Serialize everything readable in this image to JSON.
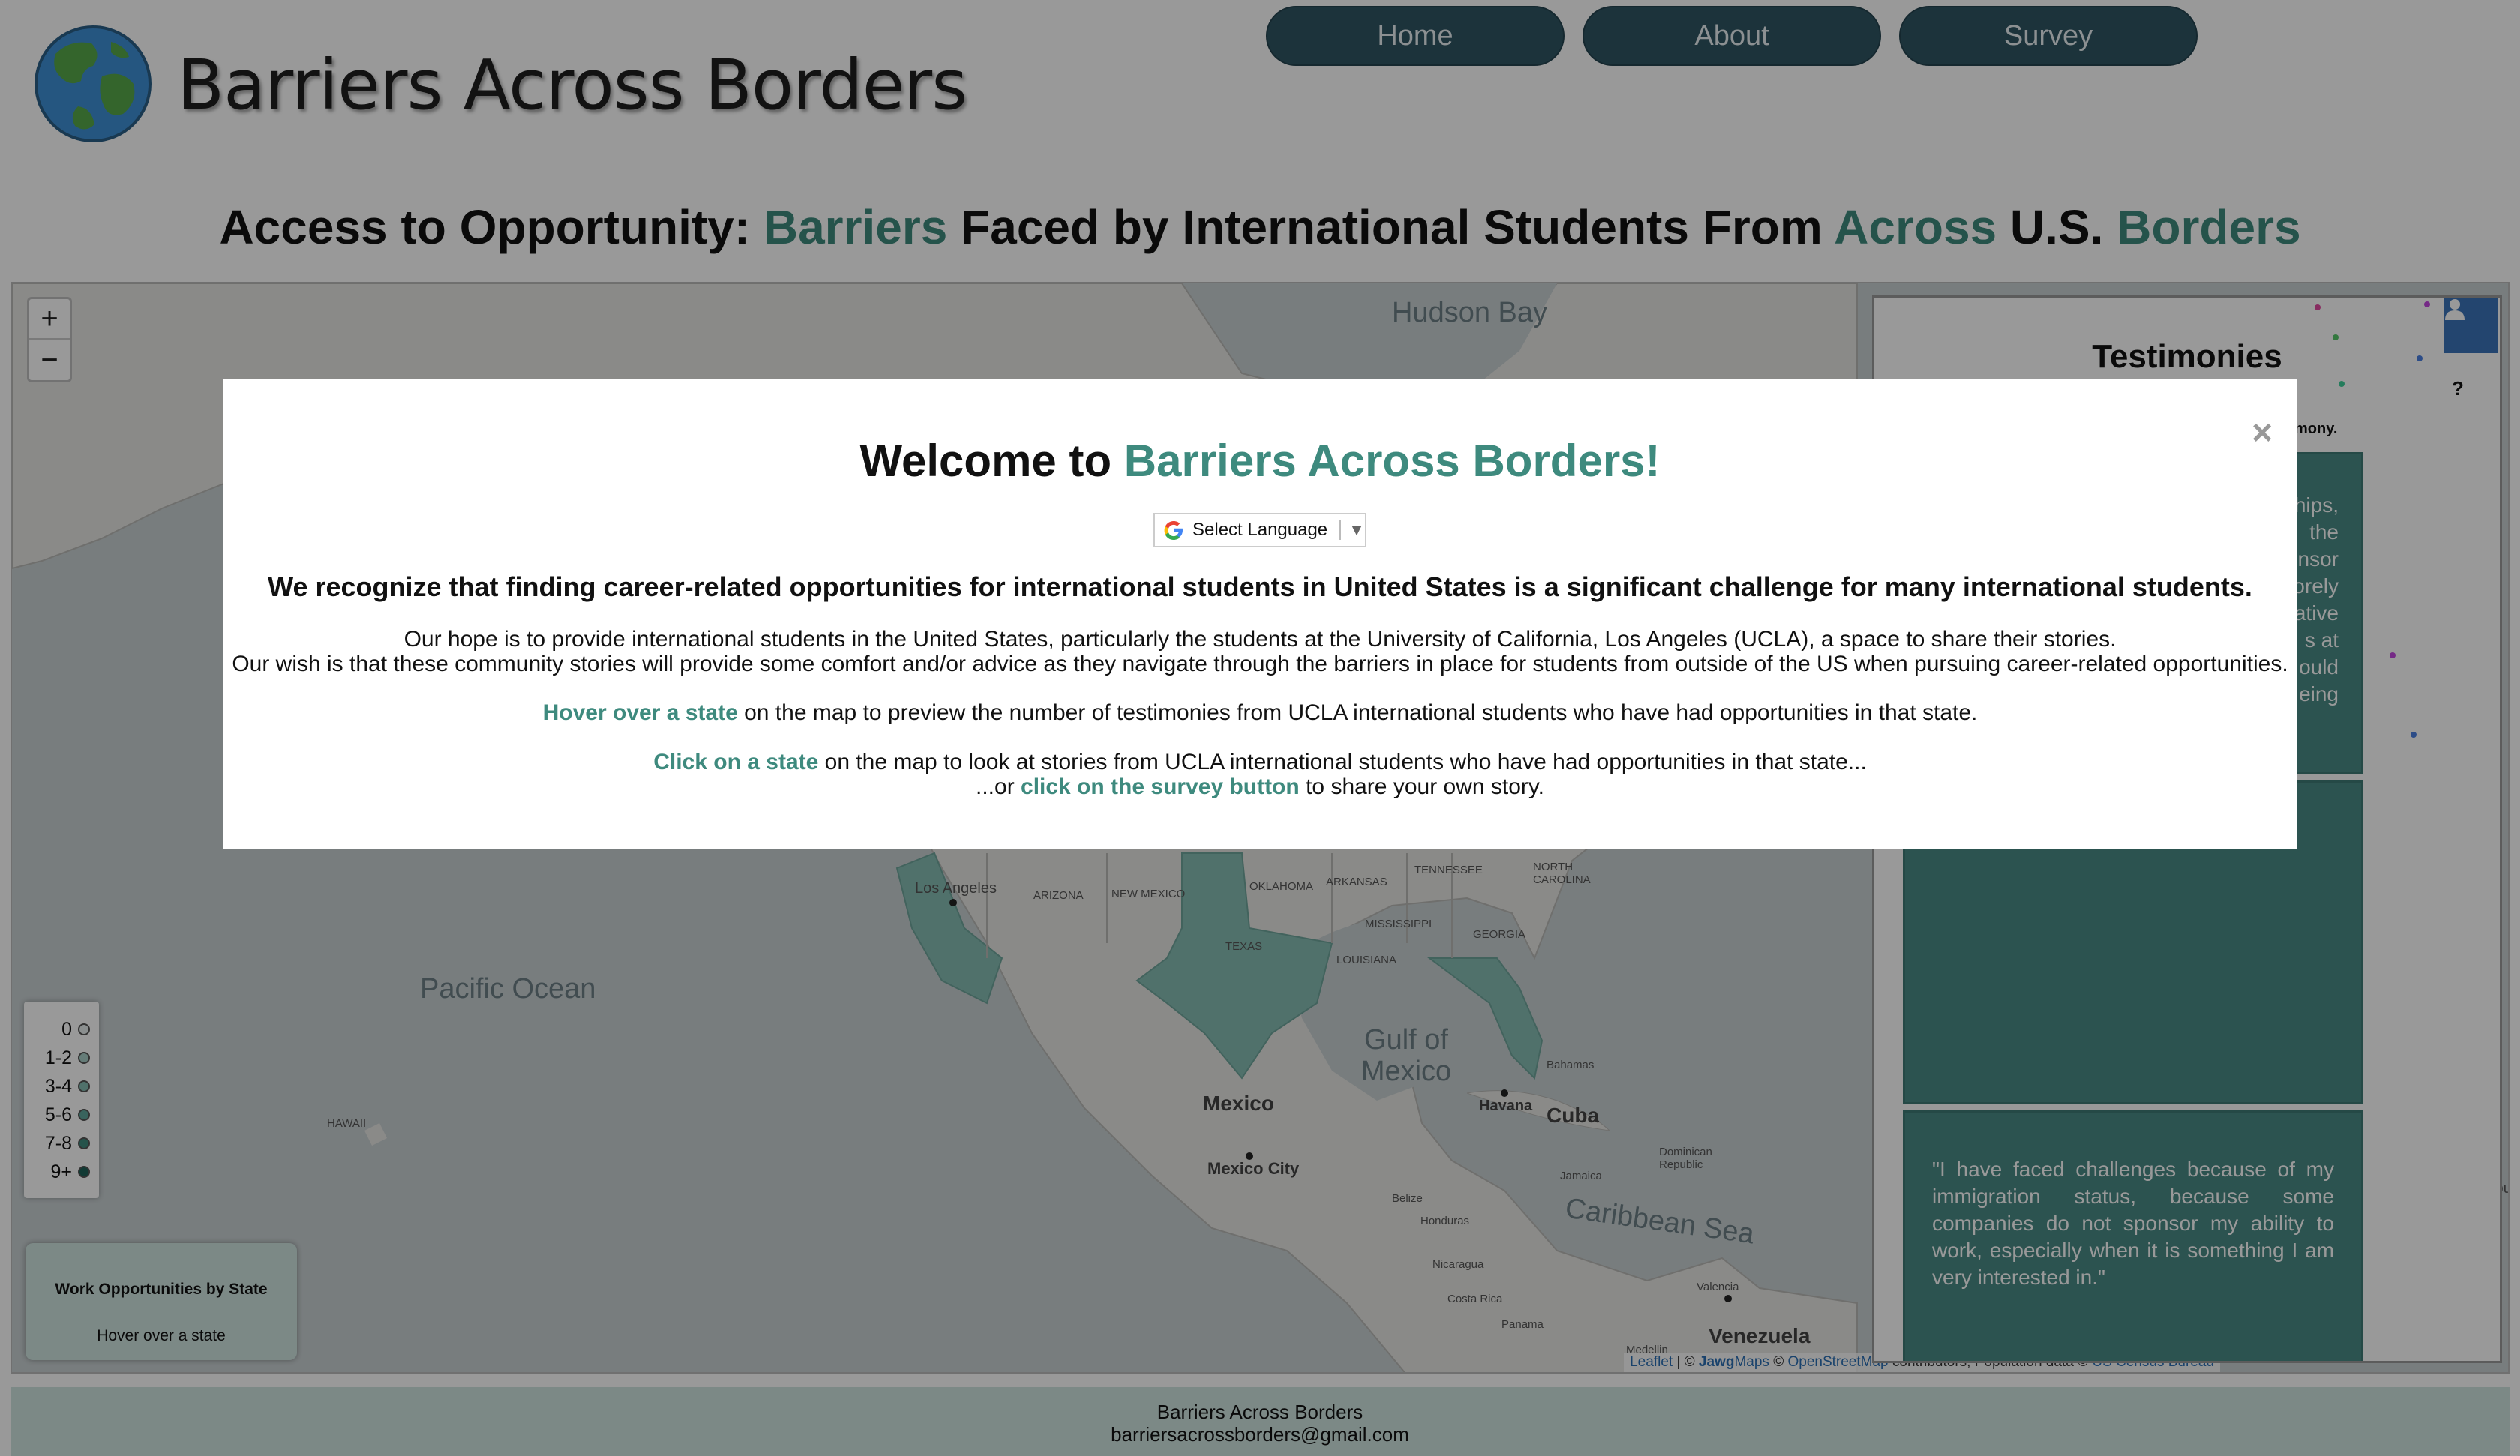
{
  "header": {
    "site_title": "Barriers Across Borders",
    "nav": {
      "home": "Home",
      "about": "About",
      "survey": "Survey"
    }
  },
  "headline": {
    "p1": "Access to Opportunity: ",
    "w1": "Barriers",
    "p2": " Faced by International Students From ",
    "w2": "Across",
    "p3": " U.S. ",
    "w3": "Borders"
  },
  "map": {
    "zoom_in": "+",
    "zoom_out": "−",
    "labels": {
      "hudson_bay": "Hudson Bay",
      "pacific_ocean": "Pacific Ocean",
      "gulf_of_mexico": "Gulf of Mexico",
      "caribbean_sea": "Caribbean Sea",
      "mexico": "Mexico",
      "mexico_city": "Mexico City",
      "cuba": "Cuba",
      "havana": "Havana",
      "venezuela": "Venezuela",
      "los_angeles": "Los Angeles",
      "bahamas": "Bahamas",
      "jamaica": "Jamaica",
      "dominican_republic": "Dominican Republic",
      "belize": "Belize",
      "honduras": "Honduras",
      "nicaragua": "Nicaragua",
      "costa_rica": "Costa Rica",
      "panama": "Panama",
      "valencia": "Valencia",
      "medellin": "Medellin",
      "hawaii": "HAWAII",
      "arizona": "ARIZONA",
      "new_mexico": "NEW MEXICO",
      "texas": "TEXAS",
      "oklahoma": "OKLAHOMA",
      "arkansas": "ARKANSAS",
      "tennessee": "TENNESSEE",
      "north_carolina": "NORTH CAROLINA",
      "mississippi": "MISSISSIPPI",
      "louisiana": "LOUISIANA",
      "georgia": "GEORGIA"
    },
    "legend": [
      {
        "label": "0",
        "color": "#e8eeee"
      },
      {
        "label": "1-2",
        "color": "#a9cfc8"
      },
      {
        "label": "3-4",
        "color": "#86bcb3"
      },
      {
        "label": "5-6",
        "color": "#5fa69b"
      },
      {
        "label": "7-8",
        "color": "#3e8a7e"
      },
      {
        "label": "9+",
        "color": "#1f6258"
      }
    ],
    "hover_box": {
      "title": "Work Opportunities by State",
      "subtitle": "Hover over a state"
    },
    "attribution": {
      "leaflet": "Leaflet",
      "sep1": " | © ",
      "jawg_bold": "Jawg",
      "jawg_rest": "Maps",
      "sep2": " © ",
      "osm": "OpenStreetMap",
      "mid": " contributors, Population data © ",
      "census": "US Census Bureau"
    }
  },
  "testimonies": {
    "title": "Testimonies",
    "help": "?",
    "note": "mony.",
    "card1_partial": [
      "hips,",
      "the",
      "nsor",
      "orely",
      "ative",
      "s at",
      "ould",
      "eing"
    ],
    "card3_text": "\"I have faced challenges because of my immigration status, because some companies do not sponsor my ability to work, especially when it is something I am very interested in.\"",
    "edge_text": "lou"
  },
  "modal": {
    "close": "×",
    "title_plain": "Welcome to ",
    "title_accent": "Barriers Across Borders!",
    "language": "Select Language",
    "language_arrow": "▼",
    "lead": "We recognize that finding career-related opportunities for international students in United States is a significant challenge for many international students.",
    "hope": "Our hope is to provide international students in the United States, particularly the students at the University of California, Los Angeles (UCLA), a space to share their stories.",
    "wish": "Our wish is that these community stories will provide some comfort and/or advice as they navigate through the barriers in place for students from outside of the US when pursuing career-related opportunities.",
    "hover_link": "Hover over a state",
    "hover_rest": " on the map to preview the number of testimonies from UCLA international students who have had opportunities in that state.",
    "click_link": "Click on a state",
    "click_rest": " on the map to look at stories from UCLA international students who have had opportunities in that state...",
    "or_pre": "...or ",
    "survey_link": "click on the survey button",
    "survey_rest": " to share your own story."
  },
  "footer": {
    "name": "Barriers Across Borders",
    "email": "barriersacrossborders@gmail.com"
  }
}
